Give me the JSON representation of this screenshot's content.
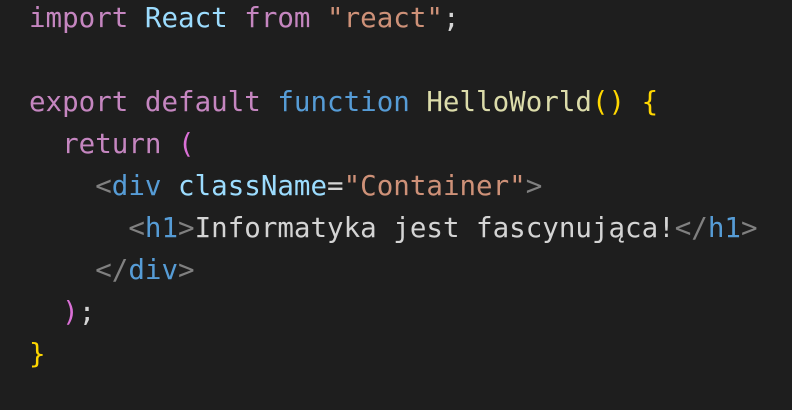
{
  "colors": {
    "background": "#1e1e1e",
    "default_text": "#d4d4d4",
    "keyword_control": "#c586c0",
    "keyword_storage": "#569cd6",
    "identifier": "#9cdcfe",
    "string": "#ce9178",
    "function_name": "#dcdcaa",
    "bracket_gold": "#ffd700",
    "bracket_orchid": "#da70d6",
    "tag_bracket": "#808080",
    "tag_name": "#569cd6"
  },
  "code": {
    "lines": [
      {
        "tokens": [
          {
            "text": "import ",
            "color": "#c586c0"
          },
          {
            "text": "React",
            "color": "#9cdcfe"
          },
          {
            "text": " from ",
            "color": "#c586c0"
          },
          {
            "text": "\"react\"",
            "color": "#ce9178"
          },
          {
            "text": ";",
            "color": "#d4d4d4"
          }
        ]
      },
      {
        "tokens": []
      },
      {
        "tokens": [
          {
            "text": "export ",
            "color": "#c586c0"
          },
          {
            "text": "default ",
            "color": "#c586c0"
          },
          {
            "text": "function ",
            "color": "#569cd6"
          },
          {
            "text": "HelloWorld",
            "color": "#dcdcaa"
          },
          {
            "text": "()",
            "color": "#ffd700"
          },
          {
            "text": " ",
            "color": "#d4d4d4"
          },
          {
            "text": "{",
            "color": "#ffd700"
          }
        ]
      },
      {
        "tokens": [
          {
            "text": "  ",
            "color": "#d4d4d4"
          },
          {
            "text": "return ",
            "color": "#c586c0"
          },
          {
            "text": "(",
            "color": "#da70d6"
          }
        ]
      },
      {
        "tokens": [
          {
            "text": "    ",
            "color": "#d4d4d4"
          },
          {
            "text": "<",
            "color": "#808080"
          },
          {
            "text": "div",
            "color": "#569cd6"
          },
          {
            "text": " ",
            "color": "#d4d4d4"
          },
          {
            "text": "className",
            "color": "#9cdcfe"
          },
          {
            "text": "=",
            "color": "#d4d4d4"
          },
          {
            "text": "\"Container\"",
            "color": "#ce9178"
          },
          {
            "text": ">",
            "color": "#808080"
          }
        ]
      },
      {
        "tokens": [
          {
            "text": "      ",
            "color": "#d4d4d4"
          },
          {
            "text": "<",
            "color": "#808080"
          },
          {
            "text": "h1",
            "color": "#569cd6"
          },
          {
            "text": ">",
            "color": "#808080"
          },
          {
            "text": "Informatyka jest fascynująca!",
            "color": "#d4d4d4"
          },
          {
            "text": "</",
            "color": "#808080"
          },
          {
            "text": "h1",
            "color": "#569cd6"
          },
          {
            "text": ">",
            "color": "#808080"
          }
        ]
      },
      {
        "tokens": [
          {
            "text": "    ",
            "color": "#d4d4d4"
          },
          {
            "text": "</",
            "color": "#808080"
          },
          {
            "text": "div",
            "color": "#569cd6"
          },
          {
            "text": ">",
            "color": "#808080"
          }
        ]
      },
      {
        "tokens": [
          {
            "text": "  ",
            "color": "#d4d4d4"
          },
          {
            "text": ")",
            "color": "#da70d6"
          },
          {
            "text": ";",
            "color": "#d4d4d4"
          }
        ]
      },
      {
        "tokens": [
          {
            "text": "}",
            "color": "#ffd700"
          }
        ]
      }
    ]
  }
}
